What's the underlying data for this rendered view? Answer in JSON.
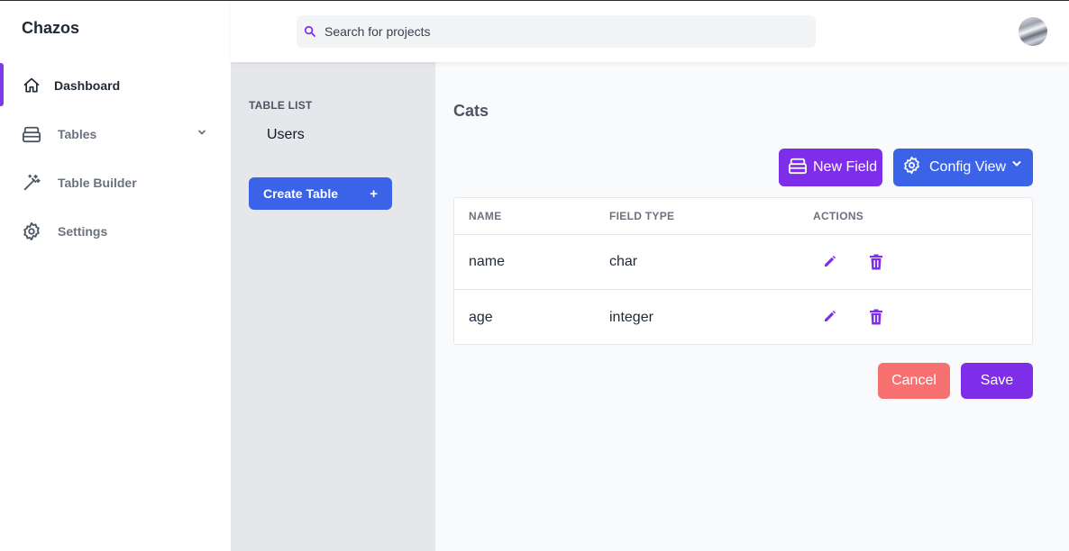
{
  "app": {
    "brand": "Chazos"
  },
  "search": {
    "placeholder": "Search for projects"
  },
  "sidebar": {
    "items": [
      {
        "label": "Dashboard",
        "icon": "home-icon",
        "active": true
      },
      {
        "label": "Tables",
        "icon": "table-icon",
        "expandable": true
      },
      {
        "label": "Table Builder",
        "icon": "magic-wand-icon"
      },
      {
        "label": "Settings",
        "icon": "gear-icon"
      }
    ]
  },
  "table_list": {
    "title": "TABLE LIST",
    "items": [
      "Users"
    ],
    "create_label": "Create Table",
    "create_icon": "+"
  },
  "main": {
    "title": "Cats",
    "new_field_label": "New Field",
    "config_view_label": "Config View",
    "columns": [
      "NAME",
      "FIELD TYPE",
      "ACTIONS"
    ],
    "rows": [
      {
        "name": "name",
        "type": "char"
      },
      {
        "name": "age",
        "type": "integer"
      }
    ],
    "cancel_label": "Cancel",
    "save_label": "Save"
  },
  "colors": {
    "accent_purple": "#7e2ee8",
    "accent_blue": "#3b63e8",
    "danger": "#f87171"
  }
}
